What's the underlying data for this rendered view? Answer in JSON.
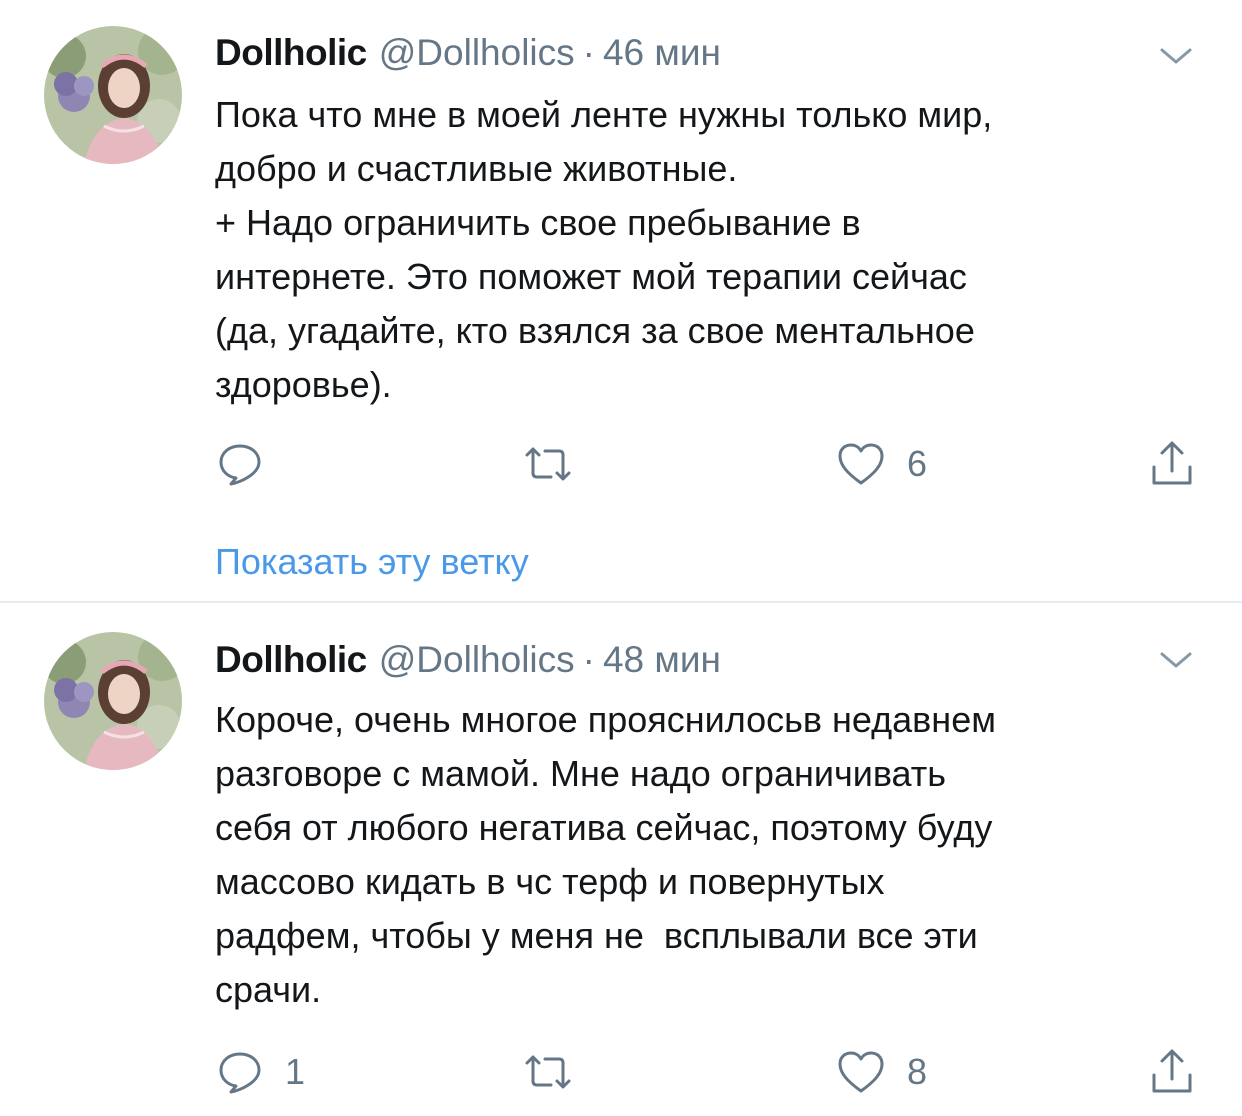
{
  "tweets": [
    {
      "display_name": "Dollholic",
      "handle": "@Dollholics",
      "separator": "·",
      "time": "46 мин",
      "text_lines": [
        "Пока что мне в моей ленте нужны только мир,",
        "добро и счастливые животные.",
        "+ Надо ограничить свое пребывание в",
        "интернете. Это поможет мой терапии сейчас",
        "(да, угадайте, кто взялся за свое ментальное",
        "здоровье)."
      ],
      "reply_count": "",
      "retweet_count": "",
      "like_count": "6",
      "show_thread": "Показать эту ветку"
    },
    {
      "display_name": "Dollholic",
      "handle": "@Dollholics",
      "separator": "·",
      "time": "48 мин",
      "text_lines": [
        "Короче, очень многое прояснилосьв недавнем",
        "разговоре с мамой. Мне надо ограничивать",
        "себя от любого негатива сейчас, поэтому буду",
        "массово кидать в чс терф и повернутых",
        "радфем, чтобы у меня не  всплывали все эти",
        "срачи."
      ],
      "reply_count": "1",
      "retweet_count": "",
      "like_count": "8"
    }
  ],
  "icons": {
    "reply": "reply-icon",
    "retweet": "retweet-icon",
    "like": "heart-icon",
    "share": "share-icon",
    "menu": "chevron-down-icon"
  },
  "colors": {
    "text": "#14171a",
    "secondary": "#657786",
    "link": "#4a99e9",
    "divider": "#e6ecf0"
  }
}
